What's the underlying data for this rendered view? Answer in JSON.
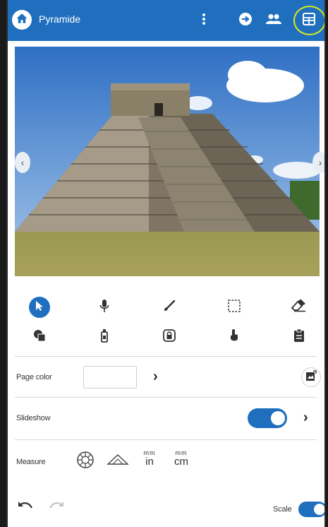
{
  "app": {
    "title": "Pyramide"
  },
  "topbar": {
    "icons": [
      "home-icon",
      "more-vertical-icon",
      "arrow-right-circle-icon",
      "people-icon",
      "grid-layout-icon"
    ],
    "accent": "#1f6fbe",
    "highlight": "#d8e81f"
  },
  "tools": {
    "row1": [
      "pointer-icon",
      "microphone-icon",
      "brush-icon",
      "select-rectangle-icon",
      "eraser-icon"
    ],
    "row2": [
      "shapes-icon",
      "spray-can-icon",
      "lock-frame-icon",
      "touch-hand-icon",
      "clipboard-icon"
    ]
  },
  "page_color": {
    "label": "Page color"
  },
  "slideshow": {
    "label": "Slideshow",
    "enabled": true
  },
  "measure": {
    "label": "Measure",
    "units": [
      {
        "small": "",
        "big": ""
      },
      {
        "small": "",
        "big": ""
      },
      {
        "small": "mm",
        "big": "in"
      },
      {
        "small": "mm",
        "big": "cm"
      }
    ]
  },
  "footer": {
    "scale_label": "Scale",
    "scale_enabled": true
  }
}
